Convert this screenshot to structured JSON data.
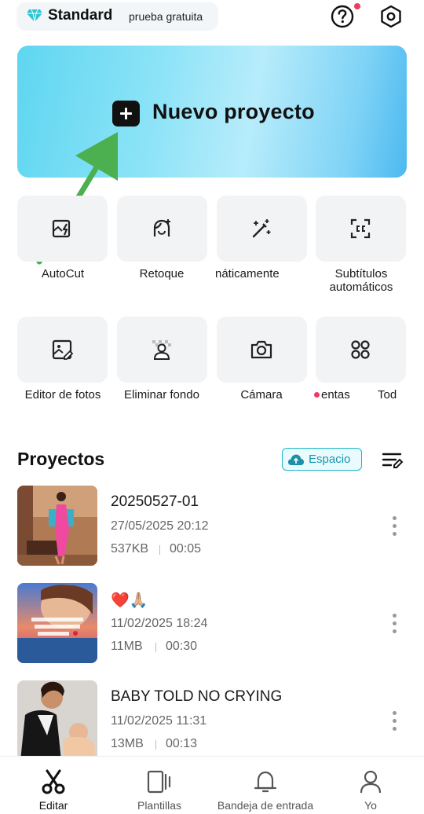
{
  "header": {
    "plan_name": "Standard",
    "plan_trial": "prueba gratuita",
    "help_icon": "help-circle-icon",
    "settings_icon": "hexagon-settings-icon"
  },
  "hero": {
    "label": "Nuevo proyecto",
    "icon": "plus-square-icon"
  },
  "tools": {
    "row1": [
      {
        "label": "AutoCut",
        "icon": "autocut-icon"
      },
      {
        "label": "Retoque",
        "icon": "retouch-face-icon"
      },
      {
        "label": "náticamente",
        "icon": "magic-wand-icon"
      },
      {
        "label": "Subtítulos automáticos",
        "icon": "captions-icon"
      }
    ],
    "row2": [
      {
        "label": "Editor de fotos",
        "icon": "photo-edit-icon"
      },
      {
        "label": "Eliminar fondo",
        "icon": "remove-background-icon"
      },
      {
        "label": "Cámara",
        "icon": "camera-icon"
      },
      {
        "label": "entas",
        "icon": "grid-apps-icon"
      },
      {
        "label": "Tod",
        "icon": ""
      }
    ]
  },
  "projects": {
    "title": "Proyectos",
    "space_label": "Espacio",
    "items": [
      {
        "title": "20250527-01",
        "date": "27/05/2025 20:12",
        "size": "537KB",
        "duration": "00:05"
      },
      {
        "title": "❤️🙏🏼",
        "date": "11/02/2025 18:24",
        "size": "11MB",
        "duration": "00:30"
      },
      {
        "title": "BABY TOLD NO CRYING",
        "date": "11/02/2025 11:31",
        "size": "13MB",
        "duration": "00:13"
      }
    ]
  },
  "nav": {
    "items": [
      {
        "label": "Editar",
        "icon": "scissors-icon",
        "active": true
      },
      {
        "label": "Plantillas",
        "icon": "templates-icon",
        "active": false
      },
      {
        "label": "Bandeja de entrada",
        "icon": "bell-icon",
        "active": false
      },
      {
        "label": "Yo",
        "icon": "person-icon",
        "active": false
      }
    ]
  },
  "colors": {
    "accent_teal": "#1fb7c6",
    "notification_red": "#f03a5f",
    "annotation_arrow": "#4caf50"
  }
}
